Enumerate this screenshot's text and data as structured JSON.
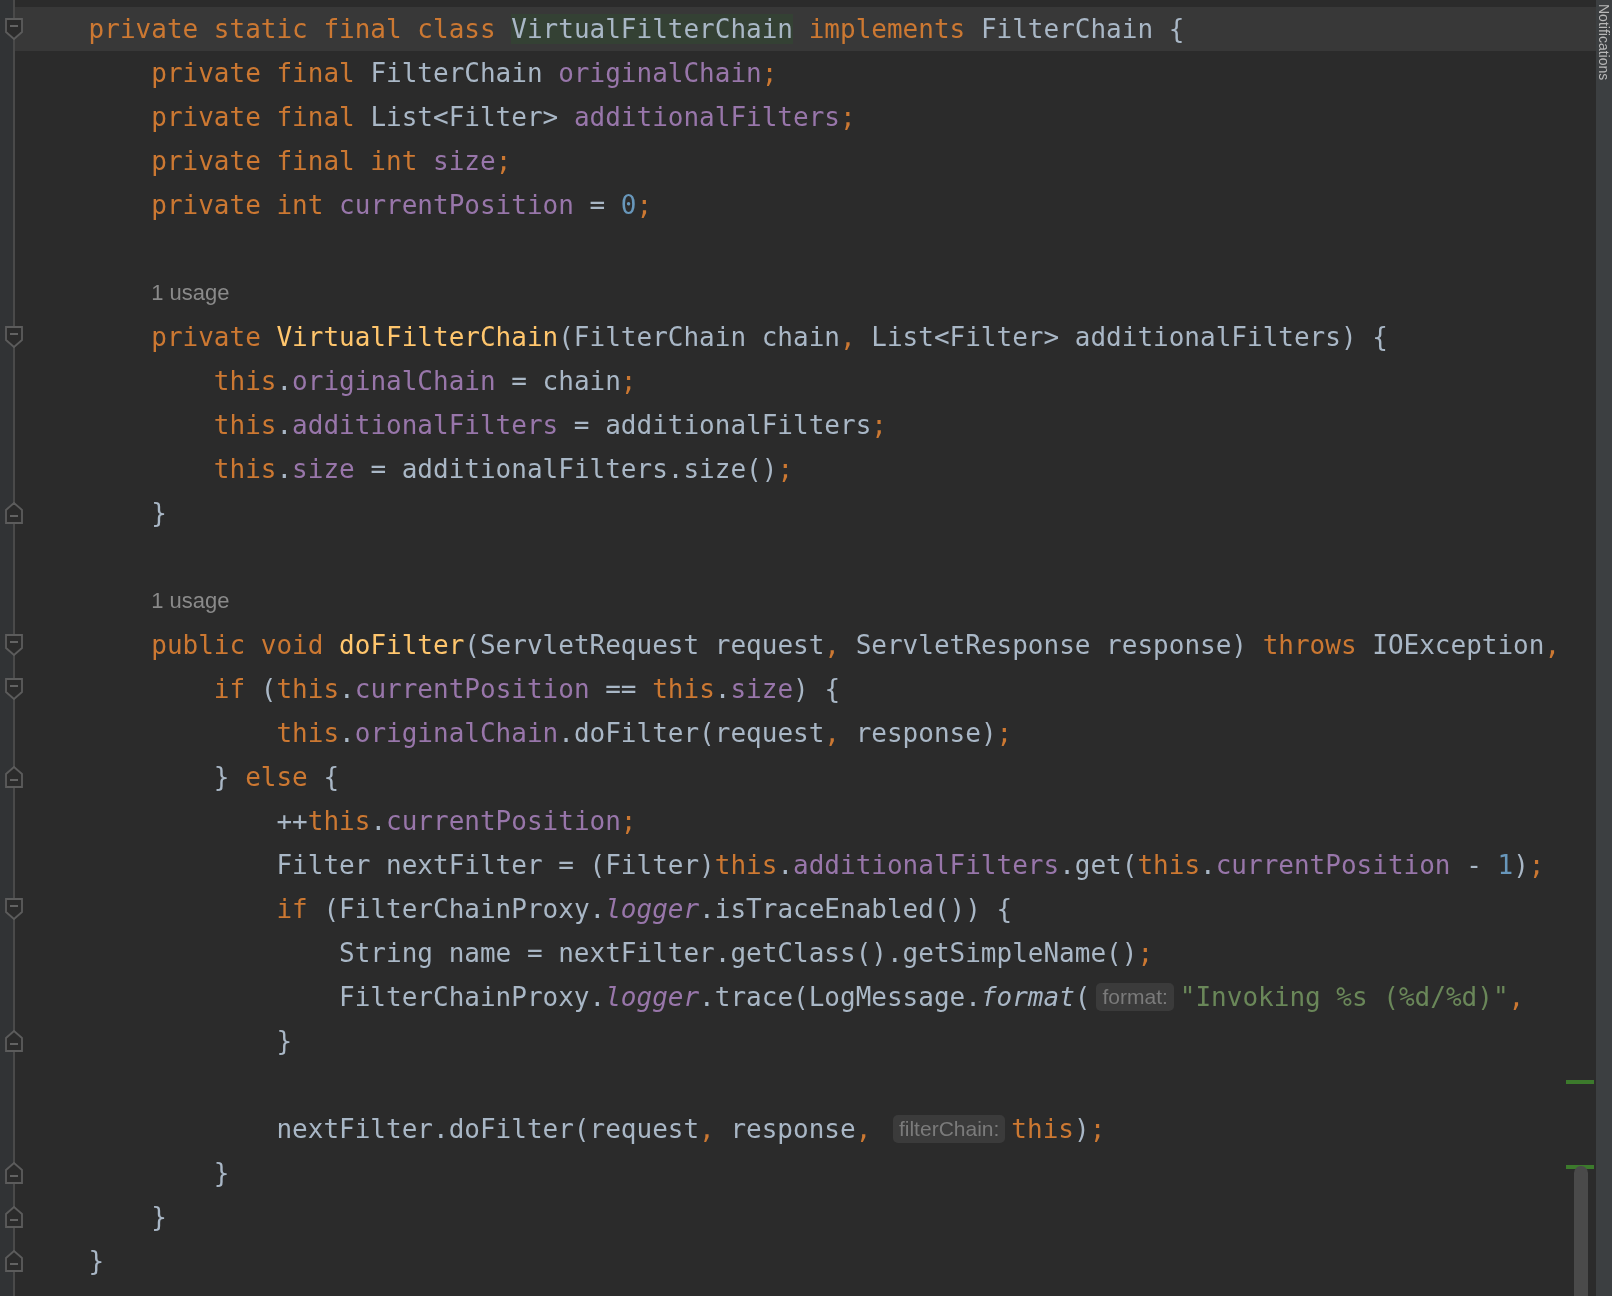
{
  "editor": {
    "lines": [
      {
        "kind": "code",
        "current": true,
        "fold_start": true,
        "segments": [
          {
            "kind": "code",
            "tokens": [
              {
                "text": "    private static final class ",
                "kind": "kw"
              },
              {
                "text": "VirtualFilterChain",
                "kind": "match"
              },
              {
                "text": " implements ",
                "kind": "kw"
              },
              {
                "text": "FilterChain {",
                "kind": "plain"
              }
            ]
          }
        ]
      },
      {
        "kind": "code",
        "current": false,
        "segments": [
          {
            "kind": "code",
            "tokens": [
              {
                "text": "        private final ",
                "kind": "kw"
              },
              {
                "text": "FilterChain ",
                "kind": "plain"
              },
              {
                "text": "originalChain",
                "kind": "field"
              },
              {
                "text": ";",
                "kind": "punct"
              }
            ]
          }
        ]
      },
      {
        "kind": "code",
        "current": false,
        "segments": [
          {
            "kind": "code",
            "tokens": [
              {
                "text": "        private final ",
                "kind": "kw"
              },
              {
                "text": "List<Filter> ",
                "kind": "plain"
              },
              {
                "text": "additionalFilters",
                "kind": "field"
              },
              {
                "text": ";",
                "kind": "punct"
              }
            ]
          }
        ]
      },
      {
        "kind": "code",
        "current": false,
        "segments": [
          {
            "kind": "code",
            "tokens": [
              {
                "text": "        private final int ",
                "kind": "kw"
              },
              {
                "text": "size",
                "kind": "field"
              },
              {
                "text": ";",
                "kind": "punct"
              }
            ]
          }
        ]
      },
      {
        "kind": "code",
        "current": false,
        "segments": [
          {
            "kind": "code",
            "tokens": [
              {
                "text": "        private int ",
                "kind": "kw"
              },
              {
                "text": "currentPosition",
                "kind": "field"
              },
              {
                "text": " = ",
                "kind": "plain"
              },
              {
                "text": "0",
                "kind": "num"
              },
              {
                "text": ";",
                "kind": "punct"
              }
            ]
          }
        ]
      },
      {
        "kind": "blank"
      },
      {
        "kind": "usage",
        "text": "1 usage"
      },
      {
        "kind": "code",
        "current": false,
        "fold_start": true,
        "segments": [
          {
            "kind": "code",
            "tokens": [
              {
                "text": "        private ",
                "kind": "kw"
              },
              {
                "text": "VirtualFilterChain",
                "kind": "decl"
              },
              {
                "text": "(FilterChain chain",
                "kind": "plain"
              },
              {
                "text": ", ",
                "kind": "punct"
              },
              {
                "text": "List<Filter> additionalFilters) {",
                "kind": "plain"
              }
            ]
          }
        ]
      },
      {
        "kind": "code",
        "current": false,
        "segments": [
          {
            "kind": "code",
            "tokens": [
              {
                "text": "            this",
                "kind": "kw"
              },
              {
                "text": ".",
                "kind": "plain"
              },
              {
                "text": "originalChain",
                "kind": "field"
              },
              {
                "text": " = chain",
                "kind": "plain"
              },
              {
                "text": ";",
                "kind": "punct"
              }
            ]
          }
        ]
      },
      {
        "kind": "code",
        "current": false,
        "segments": [
          {
            "kind": "code",
            "tokens": [
              {
                "text": "            this",
                "kind": "kw"
              },
              {
                "text": ".",
                "kind": "plain"
              },
              {
                "text": "additionalFilters",
                "kind": "field"
              },
              {
                "text": " = additionalFilters",
                "kind": "plain"
              },
              {
                "text": ";",
                "kind": "punct"
              }
            ]
          }
        ]
      },
      {
        "kind": "code",
        "current": false,
        "segments": [
          {
            "kind": "code",
            "tokens": [
              {
                "text": "            this",
                "kind": "kw"
              },
              {
                "text": ".",
                "kind": "plain"
              },
              {
                "text": "size",
                "kind": "field"
              },
              {
                "text": " = additionalFilters.size()",
                "kind": "plain"
              },
              {
                "text": ";",
                "kind": "punct"
              }
            ]
          }
        ]
      },
      {
        "kind": "code",
        "current": false,
        "fold_end": true,
        "segments": [
          {
            "kind": "code",
            "tokens": [
              {
                "text": "        }",
                "kind": "plain"
              }
            ]
          }
        ]
      },
      {
        "kind": "blank"
      },
      {
        "kind": "usage",
        "text": "1 usage"
      },
      {
        "kind": "code",
        "current": false,
        "fold_start": true,
        "segments": [
          {
            "kind": "code",
            "tokens": [
              {
                "text": "        public void ",
                "kind": "kw"
              },
              {
                "text": "doFilter",
                "kind": "decl"
              },
              {
                "text": "(ServletRequest request",
                "kind": "plain"
              },
              {
                "text": ", ",
                "kind": "punct"
              },
              {
                "text": "ServletResponse response) ",
                "kind": "plain"
              },
              {
                "text": "throws ",
                "kind": "kw"
              },
              {
                "text": "IOException",
                "kind": "plain"
              },
              {
                "text": ",",
                "kind": "punct"
              }
            ]
          }
        ]
      },
      {
        "kind": "code",
        "current": false,
        "fold_start": true,
        "segments": [
          {
            "kind": "code",
            "tokens": [
              {
                "text": "            if ",
                "kind": "kw"
              },
              {
                "text": "(",
                "kind": "plain"
              },
              {
                "text": "this",
                "kind": "kw"
              },
              {
                "text": ".",
                "kind": "plain"
              },
              {
                "text": "currentPosition",
                "kind": "field"
              },
              {
                "text": " == ",
                "kind": "plain"
              },
              {
                "text": "this",
                "kind": "kw"
              },
              {
                "text": ".",
                "kind": "plain"
              },
              {
                "text": "size",
                "kind": "field"
              },
              {
                "text": ") {",
                "kind": "plain"
              }
            ]
          }
        ]
      },
      {
        "kind": "code",
        "current": false,
        "segments": [
          {
            "kind": "code",
            "tokens": [
              {
                "text": "                this",
                "kind": "kw"
              },
              {
                "text": ".",
                "kind": "plain"
              },
              {
                "text": "originalChain",
                "kind": "field"
              },
              {
                "text": ".doFilter(request",
                "kind": "plain"
              },
              {
                "text": ", ",
                "kind": "punct"
              },
              {
                "text": "response)",
                "kind": "plain"
              },
              {
                "text": ";",
                "kind": "punct"
              }
            ]
          }
        ]
      },
      {
        "kind": "code",
        "current": false,
        "fold_end": true,
        "segments": [
          {
            "kind": "code",
            "tokens": [
              {
                "text": "            } ",
                "kind": "plain"
              },
              {
                "text": "else ",
                "kind": "kw"
              },
              {
                "text": "{",
                "kind": "plain"
              }
            ]
          }
        ]
      },
      {
        "kind": "code",
        "current": false,
        "segments": [
          {
            "kind": "code",
            "tokens": [
              {
                "text": "                ++",
                "kind": "plain"
              },
              {
                "text": "this",
                "kind": "kw"
              },
              {
                "text": ".",
                "kind": "plain"
              },
              {
                "text": "currentPosition",
                "kind": "field"
              },
              {
                "text": ";",
                "kind": "punct"
              }
            ]
          }
        ]
      },
      {
        "kind": "code",
        "current": false,
        "segments": [
          {
            "kind": "code",
            "tokens": [
              {
                "text": "                Filter nextFilter = (Filter)",
                "kind": "plain"
              },
              {
                "text": "this",
                "kind": "kw"
              },
              {
                "text": ".",
                "kind": "plain"
              },
              {
                "text": "additionalFilters",
                "kind": "field"
              },
              {
                "text": ".get(",
                "kind": "plain"
              },
              {
                "text": "this",
                "kind": "kw"
              },
              {
                "text": ".",
                "kind": "plain"
              },
              {
                "text": "currentPosition",
                "kind": "field"
              },
              {
                "text": " - ",
                "kind": "plain"
              },
              {
                "text": "1",
                "kind": "num"
              },
              {
                "text": ")",
                "kind": "plain"
              },
              {
                "text": ";",
                "kind": "punct"
              }
            ]
          }
        ]
      },
      {
        "kind": "code",
        "current": false,
        "fold_start": true,
        "segments": [
          {
            "kind": "code",
            "tokens": [
              {
                "text": "                if ",
                "kind": "kw"
              },
              {
                "text": "(FilterChainProxy.",
                "kind": "plain"
              },
              {
                "text": "logger",
                "kind": "static"
              },
              {
                "text": ".isTraceEnabled()) {",
                "kind": "plain"
              }
            ]
          }
        ]
      },
      {
        "kind": "code",
        "current": false,
        "segments": [
          {
            "kind": "code",
            "tokens": [
              {
                "text": "                    String name = nextFilter.getClass().getSimpleName()",
                "kind": "plain"
              },
              {
                "text": ";",
                "kind": "punct"
              }
            ]
          }
        ]
      },
      {
        "kind": "code",
        "current": false,
        "segments": [
          {
            "kind": "code",
            "tokens": [
              {
                "text": "                    FilterChainProxy.",
                "kind": "plain"
              },
              {
                "text": "logger",
                "kind": "static"
              },
              {
                "text": ".trace(LogMessage.",
                "kind": "plain"
              },
              {
                "text": "format",
                "kind": "italic"
              },
              {
                "text": "(",
                "kind": "plain"
              }
            ]
          },
          {
            "kind": "hint",
            "text": "format:"
          },
          {
            "kind": "code",
            "tokens": [
              {
                "text": "\"Invoking %s (%d/%d)\"",
                "kind": "str"
              },
              {
                "text": ",",
                "kind": "punct"
              }
            ]
          }
        ]
      },
      {
        "kind": "code",
        "current": false,
        "fold_end": true,
        "segments": [
          {
            "kind": "code",
            "tokens": [
              {
                "text": "                }",
                "kind": "plain"
              }
            ]
          }
        ]
      },
      {
        "kind": "blank"
      },
      {
        "kind": "code",
        "current": false,
        "segments": [
          {
            "kind": "code",
            "tokens": [
              {
                "text": "                nextFilter.doFilter(request",
                "kind": "plain"
              },
              {
                "text": ", ",
                "kind": "punct"
              },
              {
                "text": "response",
                "kind": "plain"
              },
              {
                "text": ", ",
                "kind": "punct"
              }
            ]
          },
          {
            "kind": "hint",
            "text": "filterChain:"
          },
          {
            "kind": "code",
            "tokens": [
              {
                "text": "this",
                "kind": "kw"
              },
              {
                "text": ")",
                "kind": "plain"
              },
              {
                "text": ";",
                "kind": "punct"
              }
            ]
          }
        ]
      },
      {
        "kind": "code",
        "current": false,
        "fold_end": true,
        "segments": [
          {
            "kind": "code",
            "tokens": [
              {
                "text": "            }",
                "kind": "plain"
              }
            ]
          }
        ]
      },
      {
        "kind": "code",
        "current": false,
        "fold_end": true,
        "segments": [
          {
            "kind": "code",
            "tokens": [
              {
                "text": "        }",
                "kind": "plain"
              }
            ]
          }
        ]
      },
      {
        "kind": "code",
        "current": false,
        "fold_end": true,
        "segments": [
          {
            "kind": "code",
            "tokens": [
              {
                "text": "    }",
                "kind": "plain"
              }
            ]
          }
        ]
      }
    ]
  },
  "side_panel": {
    "label": "Notifications"
  }
}
